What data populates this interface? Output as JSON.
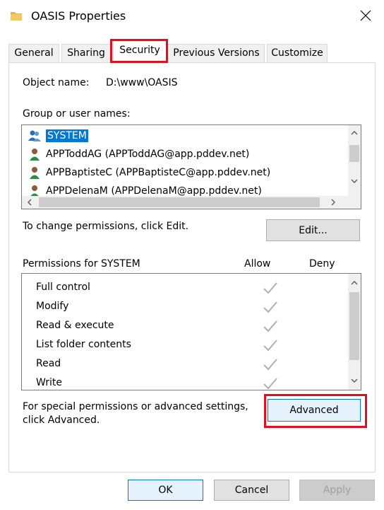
{
  "window": {
    "title": "OASIS Properties",
    "close_glyph": "✕",
    "icon": "folder-icon"
  },
  "tabs": [
    {
      "label": "General"
    },
    {
      "label": "Sharing"
    },
    {
      "label": "Security",
      "active": true
    },
    {
      "label": "Previous Versions"
    },
    {
      "label": "Customize"
    }
  ],
  "security": {
    "object_name_label": "Object name:",
    "object_name_value": "D:\\www\\OASIS",
    "group_label": "Group or user names:",
    "groups": [
      {
        "label": "SYSTEM",
        "icon": "group-users-icon",
        "selected": true
      },
      {
        "label": "APPToddAG (APPToddAG@app.pddev.net)",
        "icon": "user-icon"
      },
      {
        "label": "APPBaptisteC (APPBaptisteC@app.pddev.net)",
        "icon": "user-icon"
      },
      {
        "label": "APPDelenaM (APPDelenaM@app.pddev.net)",
        "icon": "user-icon"
      }
    ],
    "change_hint": "To change permissions, click Edit.",
    "edit_button": "Edit...",
    "permissions_label": "Permissions for SYSTEM",
    "allow_header": "Allow",
    "deny_header": "Deny",
    "permissions": [
      {
        "name": "Full control",
        "allow": true,
        "deny": false
      },
      {
        "name": "Modify",
        "allow": true,
        "deny": false
      },
      {
        "name": "Read & execute",
        "allow": true,
        "deny": false
      },
      {
        "name": "List folder contents",
        "allow": true,
        "deny": false
      },
      {
        "name": "Read",
        "allow": true,
        "deny": false
      },
      {
        "name": "Write",
        "allow": true,
        "deny": false
      }
    ],
    "advanced_hint_line1": "For special permissions or advanced settings,",
    "advanced_hint_line2": "click Advanced.",
    "advanced_button": "Advanced"
  },
  "footer": {
    "ok": "OK",
    "cancel": "Cancel",
    "apply": "Apply"
  },
  "colors": {
    "selection": "#0078d7",
    "highlight_box": "#e01020",
    "check_disabled": "#b0b0b0"
  }
}
